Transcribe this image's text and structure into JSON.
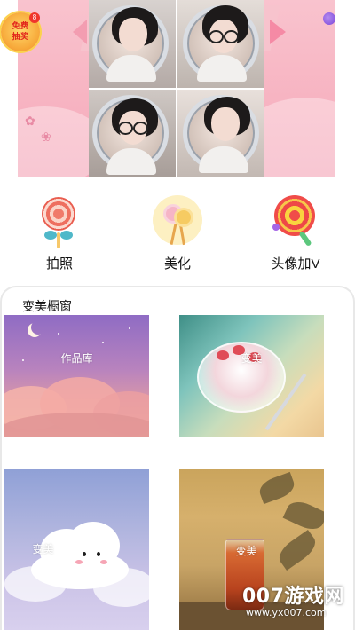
{
  "banner": {
    "prize_badge": {
      "label_line1": "免费",
      "label_line2": "抽奖",
      "count": "8"
    }
  },
  "features": [
    {
      "label": "拍照",
      "icon": "lollipop-camera-icon"
    },
    {
      "label": "美化",
      "icon": "lollipop-beautify-icon"
    },
    {
      "label": "头像加V",
      "icon": "lollipop-avatar-v-icon"
    }
  ],
  "showcase": {
    "title": "变美橱窗",
    "tiles": [
      {
        "caption": "作品库"
      },
      {
        "caption": "变美"
      },
      {
        "caption": "变美"
      },
      {
        "caption": "变美"
      }
    ]
  },
  "watermark": {
    "brand": "007游戏网",
    "url": "www.yx007.com"
  },
  "colors": {
    "banner_pink": "#f7b4c2",
    "prize_orange": "#f7a93a",
    "accent_purple": "#7b45d8"
  }
}
